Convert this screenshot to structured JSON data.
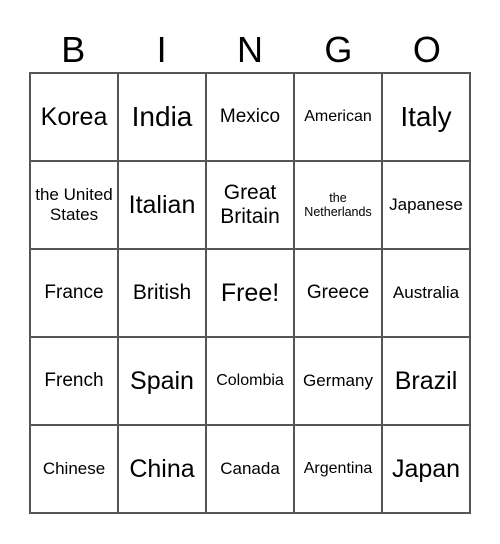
{
  "header": {
    "letters": [
      "B",
      "I",
      "N",
      "G",
      "O"
    ]
  },
  "cells": [
    [
      "Korea",
      "India",
      "Mexico",
      "American",
      "Italy"
    ],
    [
      "the United States",
      "Italian",
      "Great Britain",
      "the Netherlands",
      "Japanese"
    ],
    [
      "France",
      "British",
      "Free!",
      "Greece",
      "Australia"
    ],
    [
      "French",
      "Spain",
      "Colombia",
      "Germany",
      "Brazil"
    ],
    [
      "Chinese",
      "China",
      "Canada",
      "Argentina",
      "Japan"
    ]
  ]
}
